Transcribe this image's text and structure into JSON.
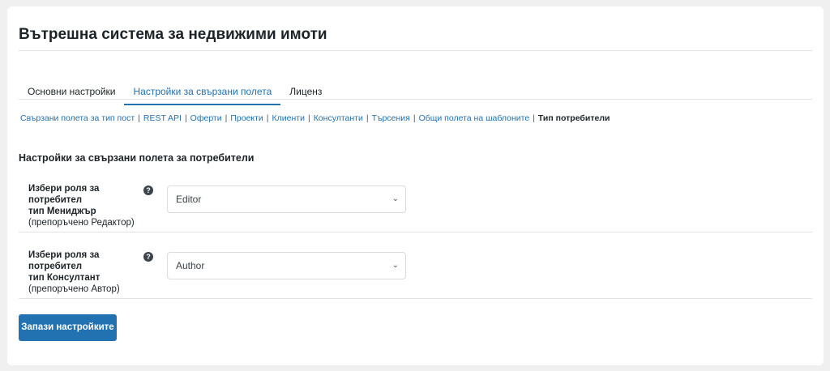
{
  "title": "Вътрешна система за недвижими имоти",
  "tabs": [
    "Основни настройки",
    "Настройки за свързани полета",
    "Лиценз"
  ],
  "subnav": [
    "Свързани полета за тип пост",
    "REST API",
    "Оферти",
    "Проекти",
    "Клиенти",
    "Консултанти",
    "Търсения",
    "Общи полета на шаблоните",
    "Тип потребители"
  ],
  "section_title": "Настройки за свързани полета за потребители",
  "rows": [
    {
      "label1": "Избери роля за потребител",
      "label2": "тип Мениджър",
      "label3": "(препоръчено Редактор)",
      "value": "Editor"
    },
    {
      "label1": "Избери роля за потребител",
      "label2": "тип Консултант",
      "label3": "(препоръчено Автор)",
      "value": "Author"
    }
  ],
  "help_glyph": "?",
  "chevron": "⌄",
  "save_label": "Запази настройките",
  "colors": {
    "accent": "#2271b1"
  }
}
